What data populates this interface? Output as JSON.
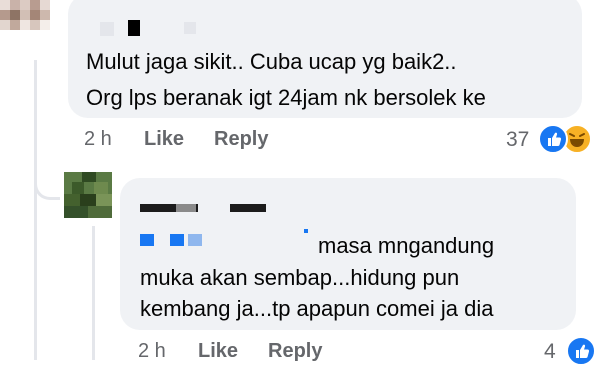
{
  "comments": [
    {
      "text_lines": [
        "Mulut jaga sikit.. Cuba ucap yg baik2..",
        "Org lps beranak igt 24jam nk bersolek ke"
      ],
      "time": "2 h",
      "like_label": "Like",
      "reply_label": "Reply",
      "reaction_count": "37",
      "reactions": [
        "like-icon",
        "haha-icon"
      ]
    },
    {
      "text_lines": [
        "masa mngandung",
        "muka akan sembap...hidung pun",
        "kembang ja...tp apapun comei ja dia"
      ],
      "time": "2 h",
      "like_label": "Like",
      "reply_label": "Reply",
      "reaction_count": "4",
      "reactions": [
        "like-icon"
      ]
    }
  ],
  "colors": {
    "bubble": "#f0f2f5",
    "meta_text": "#65676b",
    "like_blue": "#1877f2",
    "haha_yellow": "#f7b125",
    "mention_blue": "#1877f2"
  }
}
